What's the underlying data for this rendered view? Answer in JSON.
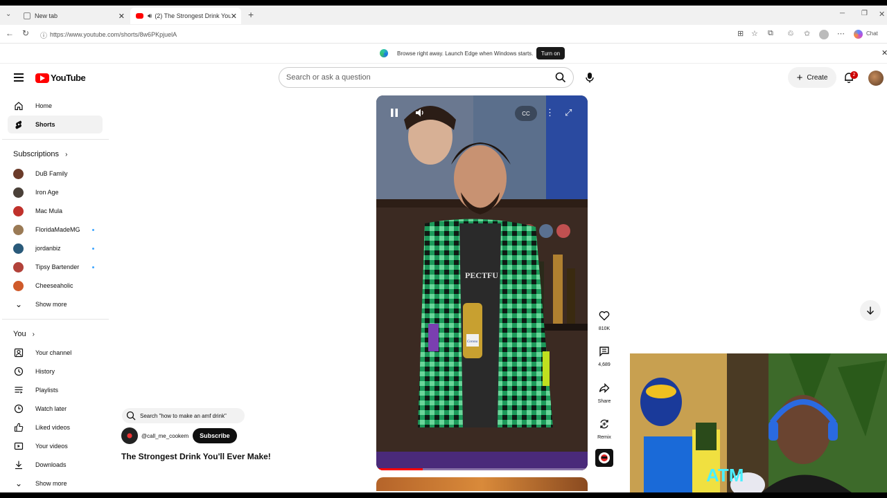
{
  "browser": {
    "tabs": [
      {
        "title": "New tab"
      },
      {
        "title": "(2) The Strongest Drink You'll"
      }
    ],
    "url": "https://www.youtube.com/shorts/8w6PKpjuelA",
    "chat_label": "Chat",
    "banner_message": "Browse right away. Launch Edge when Windows starts.",
    "banner_button": "Turn on"
  },
  "header": {
    "logo_text": "YouTube",
    "search_placeholder": "Search or ask a question",
    "create_label": "Create",
    "notification_count": "2"
  },
  "sidebar": {
    "main": [
      {
        "label": "Home",
        "icon": "home-icon"
      },
      {
        "label": "Shorts",
        "icon": "shorts-icon"
      }
    ],
    "subscriptions_title": "Subscriptions",
    "subscriptions": [
      {
        "label": "DuB Family",
        "color": "#6b3b2a",
        "dot": false
      },
      {
        "label": "Iron Age",
        "color": "#4a4038",
        "dot": false
      },
      {
        "label": "Mac Mula",
        "color": "#c0312b",
        "dot": false
      },
      {
        "label": "FloridaMadeMG",
        "color": "#9a7a55",
        "dot": true
      },
      {
        "label": "jordanbiz",
        "color": "#2a5a7a",
        "dot": true
      },
      {
        "label": "Tipsy Bartender",
        "color": "#b2423a",
        "dot": true
      },
      {
        "label": "Cheeseaholic",
        "color": "#cf5a2a",
        "dot": false
      }
    ],
    "show_more_1": "Show more",
    "you_title": "You",
    "you": [
      {
        "label": "Your channel",
        "icon": "your-channel-icon"
      },
      {
        "label": "History",
        "icon": "history-icon"
      },
      {
        "label": "Playlists",
        "icon": "playlists-icon"
      },
      {
        "label": "Watch later",
        "icon": "watch-later-icon"
      },
      {
        "label": "Liked videos",
        "icon": "liked-videos-icon"
      },
      {
        "label": "Your videos",
        "icon": "your-videos-icon"
      },
      {
        "label": "Downloads",
        "icon": "downloads-icon"
      }
    ],
    "show_more_2": "Show more"
  },
  "short": {
    "suggested_search": "Search \"how to make an amf drink\"",
    "channel_handle": "@call_me_cookem",
    "subscribe_label": "Subscribe",
    "title": "The Strongest Drink You'll Ever Make!",
    "shirt_text": "PECTFU",
    "bottle_label": "Corona",
    "progress": 0.22,
    "actions": {
      "like_count": "810K",
      "comment_count": "4,689",
      "share_label": "Share",
      "remix_label": "Remix"
    }
  },
  "webcam": {
    "neon_text": "ATM"
  }
}
